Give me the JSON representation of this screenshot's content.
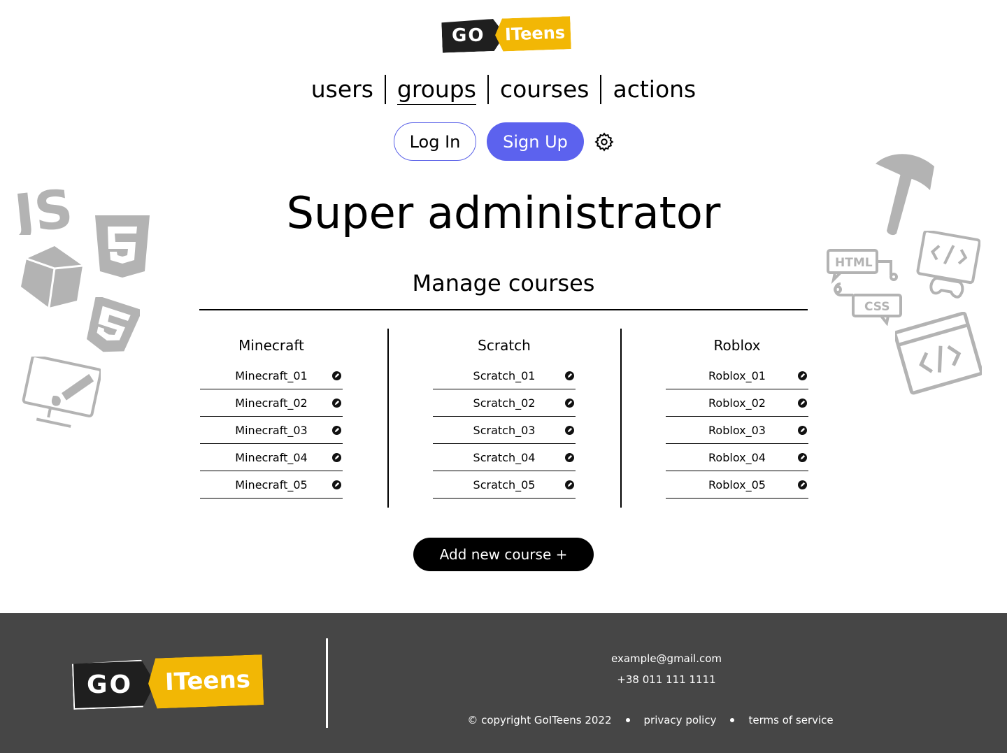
{
  "brand": {
    "logo_go": "GO",
    "logo_teens": "ITeens",
    "colors": {
      "dark": "#1f1f1f",
      "yellow": "#f2b705",
      "accent": "#5c62ee",
      "footer_bg": "#464646"
    }
  },
  "nav": {
    "items": [
      {
        "label": "users"
      },
      {
        "label": "groups",
        "active": true
      },
      {
        "label": "courses"
      },
      {
        "label": "actions"
      }
    ]
  },
  "auth": {
    "login_label": "Log In",
    "signup_label": "Sign Up",
    "settings_icon": "gear-icon"
  },
  "page": {
    "title": "Super administrator",
    "section_title": "Manage courses"
  },
  "courses": [
    {
      "name": "Minecraft",
      "groups": [
        "Minecraft_01",
        "Minecraft_02",
        "Minecraft_03",
        "Minecraft_04",
        "Minecraft_05"
      ]
    },
    {
      "name": "Scratch",
      "groups": [
        "Scratch_01",
        "Scratch_02",
        "Scratch_03",
        "Scratch_04",
        "Scratch_05"
      ]
    },
    {
      "name": "Roblox",
      "groups": [
        "Roblox_01",
        "Roblox_02",
        "Roblox_03",
        "Roblox_04",
        "Roblox_05"
      ]
    }
  ],
  "actions": {
    "add_course_label": "Add new course +"
  },
  "decorations": {
    "left": [
      "js-icon",
      "html5-icon",
      "cube-icon",
      "css3-icon",
      "monitor-brush-icon"
    ],
    "right": [
      "pickaxe-icon",
      "html-css-icon",
      "code-gamepad-icon",
      "code-window-icon"
    ],
    "html_badge": "HTML",
    "css_badge": "CSS"
  },
  "footer": {
    "email": "example@gmail.com",
    "phone": "+38 011 111 1111",
    "copyright": "© copyright GoITeens 2022",
    "privacy": "privacy policy",
    "terms": "terms of service"
  }
}
